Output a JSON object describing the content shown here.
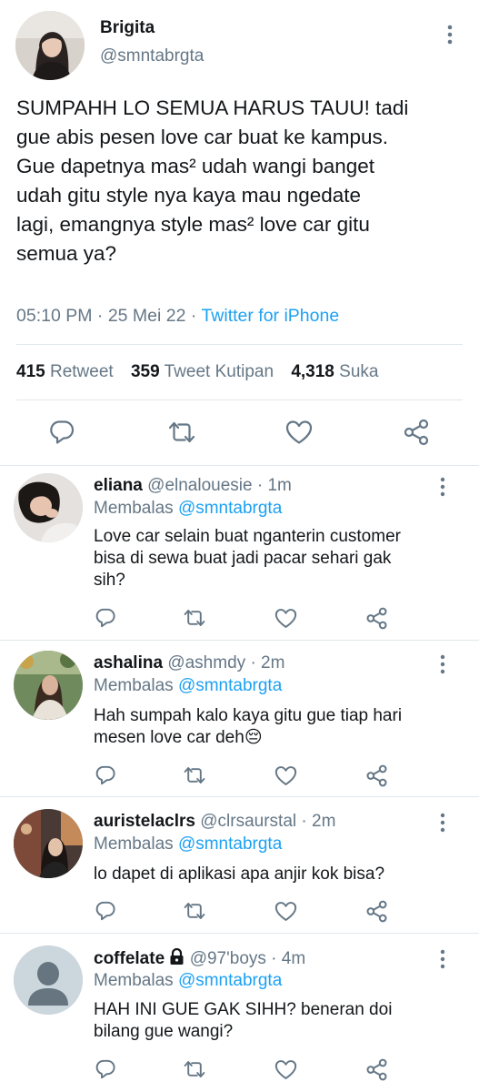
{
  "tweet": {
    "author_name": "Brigita",
    "author_handle": "@smntabrgta",
    "body_lines": [
      "SUMPAHH LO SEMUA HARUS TAUU! tadi",
      "gue abis pesen love car buat ke kampus.",
      "Gue dapetnya mas² udah wangi banget",
      "udah gitu style nya kaya mau ngedate",
      "lagi, emangnya style mas² love car gitu",
      "semua ya?"
    ],
    "time": "05:10 PM",
    "date": "25 Mei 22",
    "separator": "·",
    "source": "Twitter for iPhone",
    "retweet_count": "415",
    "retweet_label": "Retweet",
    "quote_count": "359",
    "quote_label": "Tweet Kutipan",
    "like_count": "4,318",
    "like_label": "Suka"
  },
  "replies": [
    {
      "name": "eliana",
      "handle": "@elnalouesie",
      "time": "1m",
      "replying_prefix": "Membalas",
      "replying_to": "@smntabrgta",
      "lines": [
        "Love car selain buat nganterin customer",
        "bisa di sewa buat jadi pacar sehari gak",
        "sih?"
      ]
    },
    {
      "name": "ashalina",
      "handle": "@ashmdy",
      "time": "2m",
      "replying_prefix": "Membalas",
      "replying_to": "@smntabrgta",
      "lines": [
        "Hah sumpah kalo kaya gitu gue tiap hari",
        "mesen love car deh😔"
      ]
    },
    {
      "name": "auristelaclrs",
      "handle": "@clrsaurstal",
      "time": "2m",
      "replying_prefix": "Membalas",
      "replying_to": "@smntabrgta",
      "lines": [
        "lo dapet di aplikasi apa anjir kok bisa?"
      ]
    },
    {
      "name": "coffelate",
      "handle": "@97'boys",
      "time": "4m",
      "replying_prefix": "Membalas",
      "replying_to": "@smntabrgta",
      "lines": [
        "HAH INI GUE GAK SIHH? beneran doi",
        "bilang gue wangi?"
      ]
    }
  ],
  "colors": {
    "text": "#14171a",
    "secondary": "#657786",
    "accent": "#1da1f2",
    "divider": "#e1e8ed"
  },
  "icons": [
    "more-vertical-icon",
    "reply-icon",
    "retweet-icon",
    "like-icon",
    "share-icon",
    "lock-icon",
    "default-avatar-icon"
  ]
}
